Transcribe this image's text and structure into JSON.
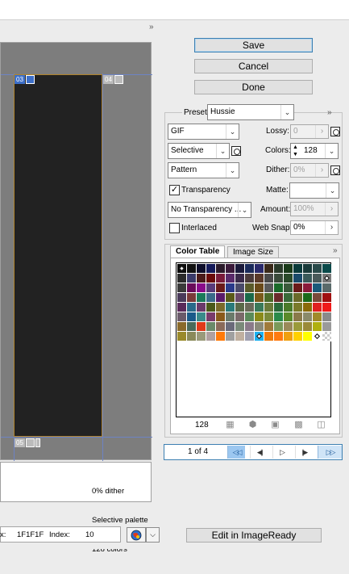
{
  "preview": {
    "expand_glyph": "»",
    "slices": [
      {
        "label": "03"
      },
      {
        "label": "04"
      },
      {
        "label": "05"
      }
    ],
    "info_lines": [
      "0% dither",
      "Selective palette",
      "128 colors"
    ]
  },
  "status": {
    "hex_label": "x:",
    "hex_value": "1F1F1F",
    "index_label": "Index:",
    "index_value": "10"
  },
  "buttons": {
    "save": "Save",
    "cancel": "Cancel",
    "done": "Done",
    "edit_imageready": "Edit in ImageReady"
  },
  "settings": {
    "preset_label": "Preset:",
    "preset_value": "Hussie",
    "format": "GIF",
    "lossy_label": "Lossy:",
    "lossy_value": "0",
    "reduction": "Selective",
    "colors_label": "Colors:",
    "colors_value": "128",
    "dither_algo": "Pattern",
    "dither_label": "Dither:",
    "dither_value": "0%",
    "transparency_label": "Transparency",
    "transparency_checked": true,
    "matte_label": "Matte:",
    "matte_value": "",
    "trans_dither": "No Transparency ...",
    "amount_label": "Amount:",
    "amount_value": "100%",
    "interlaced_label": "Interlaced",
    "interlaced_checked": false,
    "websnap_label": "Web Snap:",
    "websnap_value": "0%"
  },
  "color_table": {
    "tabs": [
      "Color Table",
      "Image Size"
    ],
    "count": "128",
    "swatches": [
      "#0a0a0a",
      "#111111",
      "#0d0d2a",
      "#141a5a",
      "#2a1a2a",
      "#3a1a3a",
      "#1a1a3a",
      "#1a2a5a",
      "#2a2a6a",
      "#3a2a1a",
      "#2a3a2a",
      "#1a3a1a",
      "#0a3a3a",
      "#1a3a3a",
      "#2a4a4a",
      "#0a4a4a",
      "#2a2a2a",
      "#3a3a6a",
      "#4a1a1a",
      "#6a0a0a",
      "#7a1a3a",
      "#5a2a6a",
      "#3a2a4a",
      "#4a3a3a",
      "#5a3a2a",
      "#4a4a4a",
      "#3a4a3a",
      "#2a4a2a",
      "#1a4a6a",
      "#3a5a5a",
      "#4a5a5a",
      "#7a7a7a",
      "#3a3a3a",
      "#6a0a5a",
      "#8a0a8a",
      "#5a3a7a",
      "#6a1a1a",
      "#2a3a8a",
      "#4a4a6a",
      "#5a5a2a",
      "#6a4a1a",
      "#5a5a5a",
      "#1a6a2a",
      "#3a5a3a",
      "#6a1a1a",
      "#8a1a3a",
      "#1a5a7a",
      "#5a6a6a",
      "#4a3a5a",
      "#7a3a3a",
      "#1a7a5a",
      "#3a6a8a",
      "#5a1a6a",
      "#5a5a1a",
      "#6a4a6a",
      "#1a6a4a",
      "#7a5a1a",
      "#4a6a2a",
      "#6a2a2a",
      "#3a6a3a",
      "#6a6a2a",
      "#1a6a1a",
      "#7a4a3a",
      "#a01010",
      "#5a2a5a",
      "#2a6a8a",
      "#6a3a6a",
      "#4a5a1a",
      "#7a6a2a",
      "#2a7a7a",
      "#5a6a4a",
      "#6a6a5a",
      "#3a7a5a",
      "#6a7a3a",
      "#2a6a3a",
      "#4a7a2a",
      "#7a7a2a",
      "#8a6a0a",
      "#e02020",
      "#f01a1a",
      "#6a5a6a",
      "#1a5a8a",
      "#3a8a8a",
      "#7a3a6a",
      "#8a5a1a",
      "#6a7a6a",
      "#7a6a6a",
      "#5a8a5a",
      "#8a8a1a",
      "#7a8a3a",
      "#2a8a4a",
      "#5a8a2a",
      "#8a7a4a",
      "#8a8a6a",
      "#a08a2a",
      "#8a8a8a",
      "#8a6a2a",
      "#4a6a5a",
      "#e03a1a",
      "#6a8a6a",
      "#8a6a5a",
      "#6a6a7a",
      "#7a8a7a",
      "#8a7a8a",
      "#8a8a7a",
      "#a07a3a",
      "#7a9a5a",
      "#9a8a5a",
      "#9a9a3a",
      "#9a8a3a",
      "#b0b010",
      "#9a9a9a",
      "#9a8a2a",
      "#8a8a5a",
      "#9a9a7a",
      "#b0a0a0",
      "#ff7a0a",
      "#a0a0a0",
      "#c0b0a0",
      "#a0a0b0",
      "#1ab0f0",
      "#f07a0a",
      "#ff7a10",
      "#f0a010",
      "#ffd000",
      "#ffff00",
      "#ffffff",
      "trans"
    ],
    "marked": [
      0,
      31,
      120,
      126
    ]
  },
  "animation": {
    "frame_label": "1 of 4"
  }
}
